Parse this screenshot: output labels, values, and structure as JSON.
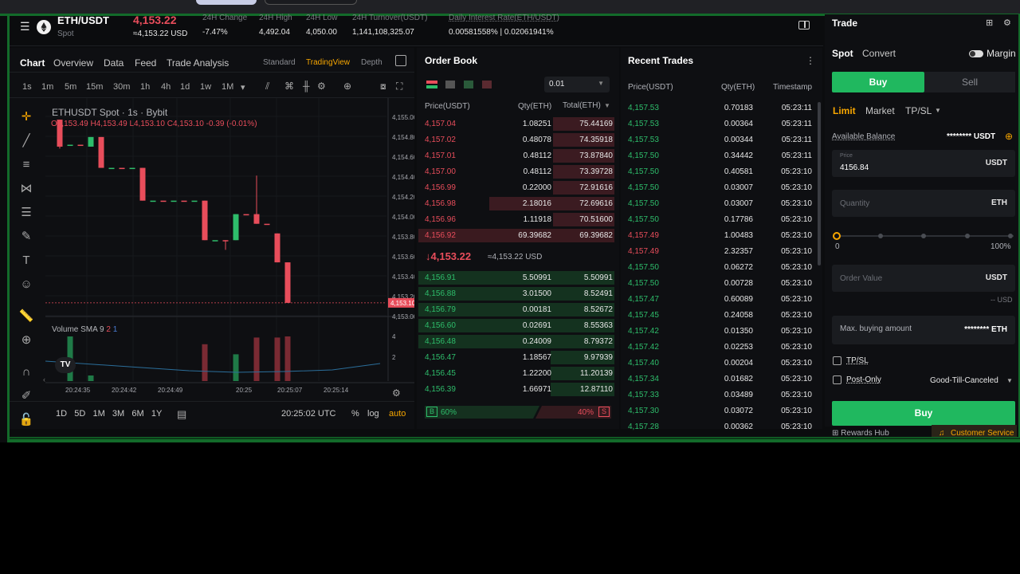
{
  "header": {
    "pair": "ETH/USDT",
    "type": "Spot",
    "price": "4,153.22",
    "price_usd": "≈4,153.22 USD",
    "stats": [
      {
        "label": "24H Change",
        "value": "-7.47%"
      },
      {
        "label": "24H High",
        "value": "4,492.04"
      },
      {
        "label": "24H Low",
        "value": "4,050.00"
      },
      {
        "label": "24H Turnover(USDT)",
        "value": "1,141,108,325.07"
      },
      {
        "label": "Daily Interest Rate(ETH/USDT)",
        "value": "0.00581558% | 0.02061941%"
      }
    ]
  },
  "chart": {
    "tabs": [
      "Chart",
      "Overview",
      "Data",
      "Feed",
      "Trade Analysis"
    ],
    "views": [
      "Standard",
      "TradingView",
      "Depth"
    ],
    "timeframes": [
      "1s",
      "1m",
      "5m",
      "15m",
      "30m",
      "1h",
      "4h",
      "1d",
      "1w",
      "1M"
    ],
    "title": "ETHUSDT Spot · 1s · Bybit",
    "ohlc": {
      "o": "O4,153.49",
      "h": "H4,153.49",
      "l": "L4,153.10",
      "c": "C4,153.10",
      "chg": "-0.39 (-0.01%)"
    },
    "y_ticks": [
      "4,155.00",
      "4,154.80",
      "4,154.60",
      "4,154.40",
      "4,154.20",
      "4,154.00",
      "4,153.80",
      "4,153.60",
      "4,153.40",
      "4,153.20",
      "4,153.00"
    ],
    "current_label": "4,153.10",
    "volume_label": "Volume SMA 9",
    "volume_params": [
      "2",
      "1"
    ],
    "vol_ticks": [
      "4",
      "2"
    ],
    "x_ticks": [
      "20:24:35",
      "20:24:42",
      "20:24:49",
      "20:25",
      "20:25:07",
      "20:25:14"
    ],
    "ranges": [
      "1D",
      "5D",
      "1M",
      "3M",
      "6M",
      "1Y"
    ],
    "clock": "20:25:02 UTC",
    "bottom_opts": [
      "%",
      "log",
      "auto"
    ],
    "tv_logo": "TV",
    "chart_data": {
      "type": "candlestick",
      "title": "ETHUSDT Spot · 1s · Bybit",
      "ylim": [
        4152.95,
        4155.1
      ],
      "candles": [
        {
          "t": 0,
          "o": 4155.0,
          "h": 4155.0,
          "l": 4154.7,
          "c": 4154.72
        },
        {
          "t": 1,
          "o": 4154.74,
          "h": 4154.74,
          "l": 4154.74,
          "c": 4154.74
        },
        {
          "t": 2,
          "o": 4154.74,
          "h": 4154.74,
          "l": 4154.74,
          "c": 4154.74
        },
        {
          "t": 3,
          "o": 4154.72,
          "h": 4154.82,
          "l": 4154.72,
          "c": 4154.82
        },
        {
          "t": 4,
          "o": 4154.82,
          "h": 4154.82,
          "l": 4154.5,
          "c": 4154.5
        },
        {
          "t": 5,
          "o": 4154.5,
          "h": 4154.5,
          "l": 4154.5,
          "c": 4154.5
        },
        {
          "t": 6,
          "o": 4154.5,
          "h": 4154.5,
          "l": 4154.5,
          "c": 4154.5
        },
        {
          "t": 7,
          "o": 4154.5,
          "h": 4154.5,
          "l": 4154.5,
          "c": 4154.5
        },
        {
          "t": 8,
          "o": 4154.5,
          "h": 4154.5,
          "l": 4154.16,
          "c": 4154.16
        },
        {
          "t": 9,
          "o": 4154.16,
          "h": 4154.16,
          "l": 4154.16,
          "c": 4154.16
        },
        {
          "t": 10,
          "o": 4154.16,
          "h": 4154.16,
          "l": 4154.16,
          "c": 4154.16
        },
        {
          "t": 11,
          "o": 4154.16,
          "h": 4154.16,
          "l": 4154.16,
          "c": 4154.16
        },
        {
          "t": 12,
          "o": 4154.16,
          "h": 4154.16,
          "l": 4154.16,
          "c": 4154.16
        },
        {
          "t": 13,
          "o": 4154.16,
          "h": 4154.16,
          "l": 4154.16,
          "c": 4154.16
        },
        {
          "t": 14,
          "o": 4154.16,
          "h": 4154.16,
          "l": 4153.75,
          "c": 4153.75
        },
        {
          "t": 15,
          "o": 4153.75,
          "h": 4153.75,
          "l": 4153.75,
          "c": 4153.75
        },
        {
          "t": 16,
          "o": 4153.75,
          "h": 4153.75,
          "l": 4153.65,
          "c": 4153.75
        },
        {
          "t": 17,
          "o": 4153.75,
          "h": 4154.02,
          "l": 4153.75,
          "c": 4154.02
        },
        {
          "t": 18,
          "o": 4154.02,
          "h": 4154.02,
          "l": 4154.02,
          "c": 4154.02
        },
        {
          "t": 19,
          "o": 4154.02,
          "h": 4154.42,
          "l": 4153.92,
          "c": 4153.92
        },
        {
          "t": 20,
          "o": 4153.92,
          "h": 4153.92,
          "l": 4153.92,
          "c": 4153.92
        },
        {
          "t": 21,
          "o": 4153.82,
          "h": 4153.82,
          "l": 4153.52,
          "c": 4153.52
        },
        {
          "t": 22,
          "o": 4153.52,
          "h": 4153.52,
          "l": 4153.1,
          "c": 4153.1
        }
      ],
      "volume": [
        0,
        4.0,
        0,
        0.5,
        0,
        0,
        0,
        0,
        0,
        0,
        0,
        0,
        0,
        0,
        3.3,
        0,
        0,
        2.4,
        0,
        3.9,
        0,
        3.9,
        4.0
      ],
      "volume_up": [
        false,
        true,
        false,
        true,
        false,
        false,
        false,
        false,
        false,
        false,
        false,
        false,
        false,
        false,
        false,
        false,
        false,
        true,
        false,
        false,
        false,
        false,
        false
      ]
    }
  },
  "orderbook": {
    "title": "Order Book",
    "precision": "0.01",
    "cols": [
      "Price(USDT)",
      "Qty(ETH)",
      "Total(ETH)"
    ],
    "asks": [
      {
        "p": "4,157.04",
        "q": "1.08251",
        "t": "75.44169",
        "depth": 0.98
      },
      {
        "p": "4,157.02",
        "q": "0.48078",
        "t": "74.35918",
        "depth": 0.96
      },
      {
        "p": "4,157.01",
        "q": "0.48112",
        "t": "73.87840",
        "depth": 0.95
      },
      {
        "p": "4,157.00",
        "q": "0.48112",
        "t": "73.39728",
        "depth": 0.95
      },
      {
        "p": "4,156.99",
        "q": "0.22000",
        "t": "72.91616",
        "depth": 0.94
      },
      {
        "p": "4,156.98",
        "q": "2.18016",
        "t": "72.69616",
        "depth": 0.94
      },
      {
        "p": "4,156.96",
        "q": "1.11918",
        "t": "70.51600",
        "depth": 0.91
      },
      {
        "p": "4,156.92",
        "q": "69.39682",
        "t": "69.39682",
        "depth": 0.9
      }
    ],
    "mid_price": "4,153.22",
    "mid_usd": "≈4,153.22 USD",
    "bids": [
      {
        "p": "4,156.91",
        "q": "5.50991",
        "t": "5.50991",
        "depth": 0.98
      },
      {
        "p": "4,156.88",
        "q": "3.01500",
        "t": "8.52491",
        "depth": 0.97
      },
      {
        "p": "4,156.79",
        "q": "0.00181",
        "t": "8.52672",
        "depth": 0.96
      },
      {
        "p": "4,156.60",
        "q": "0.02691",
        "t": "8.55363",
        "depth": 0.96
      },
      {
        "p": "4,156.48",
        "q": "0.24009",
        "t": "8.79372",
        "depth": 0.95
      },
      {
        "p": "4,156.47",
        "q": "1.18567",
        "t": "9.97939",
        "depth": 0.94
      },
      {
        "p": "4,156.45",
        "q": "1.22200",
        "t": "11.20139",
        "depth": 0.92
      },
      {
        "p": "4,156.39",
        "q": "1.66971",
        "t": "12.87110",
        "depth": 0.9
      }
    ],
    "ratio": {
      "buy_label": "B",
      "buy": "60%",
      "sell": "40%",
      "sell_label": "S",
      "buy_pct": 60
    }
  },
  "trades": {
    "title": "Recent Trades",
    "cols": [
      "Price(USDT)",
      "Qty(ETH)",
      "Timestamp"
    ],
    "rows": [
      {
        "p": "4,157.53",
        "q": "0.70183",
        "t": "05:23:11",
        "side": "buy"
      },
      {
        "p": "4,157.53",
        "q": "0.00364",
        "t": "05:23:11",
        "side": "buy"
      },
      {
        "p": "4,157.53",
        "q": "0.00344",
        "t": "05:23:11",
        "side": "buy"
      },
      {
        "p": "4,157.50",
        "q": "0.34442",
        "t": "05:23:11",
        "side": "buy"
      },
      {
        "p": "4,157.50",
        "q": "0.40581",
        "t": "05:23:10",
        "side": "buy"
      },
      {
        "p": "4,157.50",
        "q": "0.03007",
        "t": "05:23:10",
        "side": "buy"
      },
      {
        "p": "4,157.50",
        "q": "0.03007",
        "t": "05:23:10",
        "side": "buy"
      },
      {
        "p": "4,157.50",
        "q": "0.17786",
        "t": "05:23:10",
        "side": "buy"
      },
      {
        "p": "4,157.49",
        "q": "1.00483",
        "t": "05:23:10",
        "side": "sell"
      },
      {
        "p": "4,157.49",
        "q": "2.32357",
        "t": "05:23:10",
        "side": "sell"
      },
      {
        "p": "4,157.50",
        "q": "0.06272",
        "t": "05:23:10",
        "side": "buy"
      },
      {
        "p": "4,157.50",
        "q": "0.00728",
        "t": "05:23:10",
        "side": "buy"
      },
      {
        "p": "4,157.47",
        "q": "0.60089",
        "t": "05:23:10",
        "side": "buy"
      },
      {
        "p": "4,157.45",
        "q": "0.24058",
        "t": "05:23:10",
        "side": "buy"
      },
      {
        "p": "4,157.42",
        "q": "0.01350",
        "t": "05:23:10",
        "side": "buy"
      },
      {
        "p": "4,157.42",
        "q": "0.02253",
        "t": "05:23:10",
        "side": "buy"
      },
      {
        "p": "4,157.40",
        "q": "0.00204",
        "t": "05:23:10",
        "side": "buy"
      },
      {
        "p": "4,157.34",
        "q": "0.01682",
        "t": "05:23:10",
        "side": "buy"
      },
      {
        "p": "4,157.33",
        "q": "0.03489",
        "t": "05:23:10",
        "side": "buy"
      },
      {
        "p": "4,157.30",
        "q": "0.03072",
        "t": "05:23:10",
        "side": "buy"
      },
      {
        "p": "4,157.28",
        "q": "0.00362",
        "t": "05:23:10",
        "side": "buy"
      }
    ]
  },
  "trade": {
    "title": "Trade",
    "modes": [
      "Spot",
      "Convert"
    ],
    "margin": "Margin",
    "buy": "Buy",
    "sell": "Sell",
    "order_types": [
      "Limit",
      "Market",
      "TP/SL"
    ],
    "available_label": "Available Balance",
    "available_value": "******** USDT",
    "price_label": "Price",
    "price_value": "4156.84",
    "price_unit": "USDT",
    "quantity_placeholder": "Quantity",
    "quantity_unit": "ETH",
    "slider_min": "0",
    "slider_max": "100%",
    "slider_level": 0,
    "order_value_placeholder": "Order Value",
    "order_value_unit": "USDT",
    "usd_est": "-- USD",
    "max_label": "Max. buying amount",
    "max_value": "******** ETH",
    "tpsl": "TP/SL",
    "post_only": "Post-Only",
    "tif": "Good-Till-Canceled",
    "buy_button": "Buy",
    "rewards": "Rewards Hub",
    "support": "Customer Service"
  },
  "colors": {
    "green": "#2ebd6b",
    "red": "#e84d5b",
    "orange": "#f7a600",
    "bg": "#0e0f12"
  }
}
